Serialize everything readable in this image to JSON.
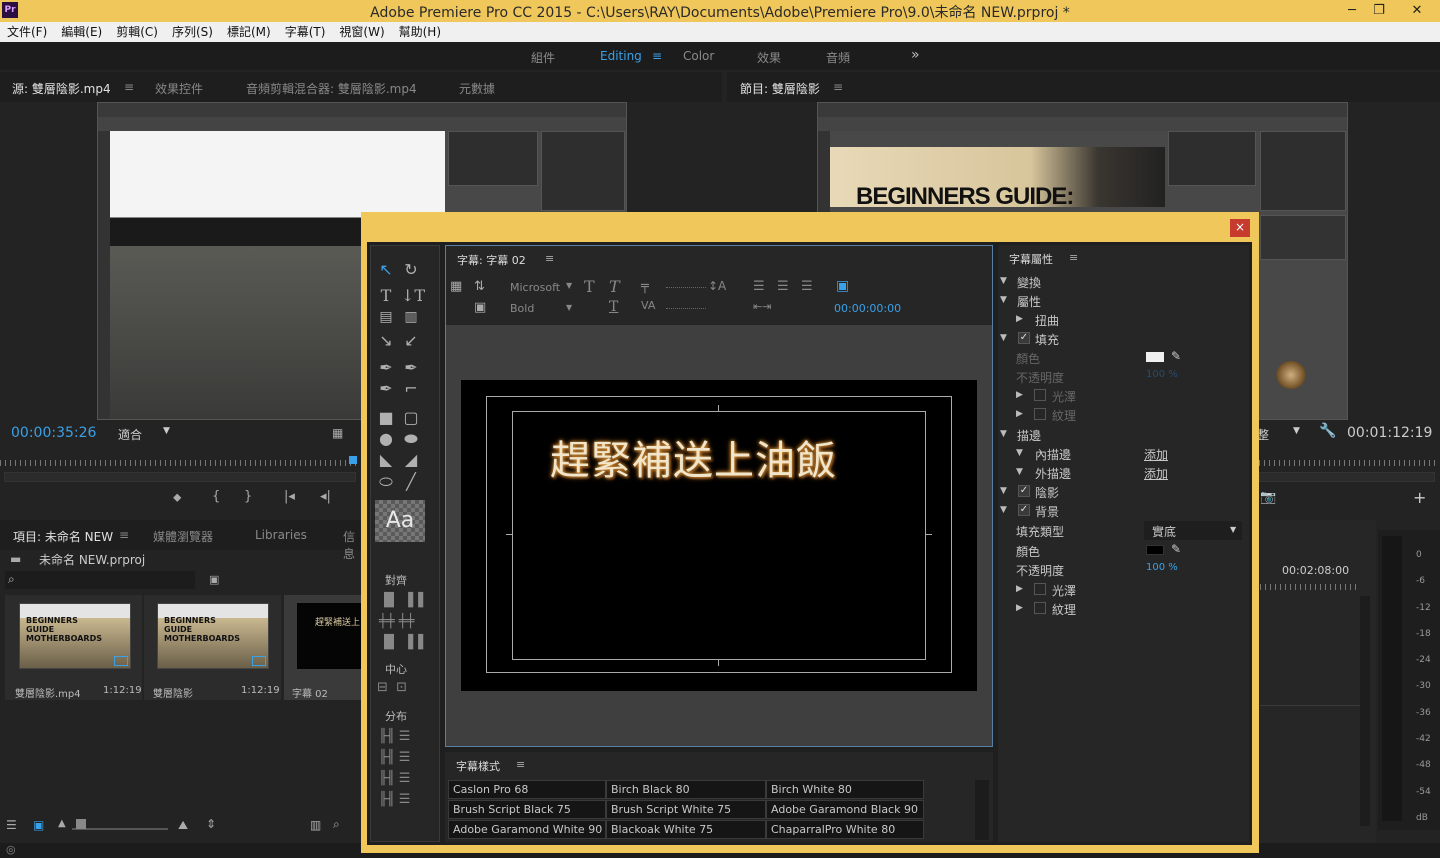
{
  "app": {
    "title": "Adobe Premiere Pro CC 2015 - C:\\Users\\RAY\\Documents\\Adobe\\Premiere Pro\\9.0\\未命名 NEW.prproj *",
    "logo": "Pr"
  },
  "menu": [
    "文件(F)",
    "編輯(E)",
    "剪輯(C)",
    "序列(S)",
    "標記(M)",
    "字幕(T)",
    "視窗(W)",
    "幫助(H)"
  ],
  "workspaces": {
    "items": [
      "組件",
      "Editing",
      "Color",
      "效果",
      "音頻"
    ],
    "active": "Editing",
    "more": "»"
  },
  "source": {
    "tabs": [
      "源: 雙層陰影.mp4",
      "效果控件",
      "音頻剪輯混合器: 雙層陰影.mp4",
      "元數據"
    ],
    "timecode": "00:00:35:26",
    "fit": "適合"
  },
  "program": {
    "tab": "節目: 雙層陰影",
    "timecode": "00:01:12:19",
    "fit": "整",
    "thumbtext": "BEGINNERS GUIDE:"
  },
  "project": {
    "tabs": [
      "項目: 未命名 NEW",
      "媒體瀏覽器",
      "Libraries",
      "信息"
    ],
    "file": "未命名 NEW.prproj",
    "items": [
      {
        "name": "雙層陰影.mp4",
        "duration": "1:12:19",
        "thumb": "BEGINNERS GUIDE MOTHERBOARDS"
      },
      {
        "name": "雙層陰影",
        "duration": "1:12:19",
        "thumb": "BEGINNERS GUIDE MOTHERBOARDS"
      },
      {
        "name": "字幕 02",
        "duration": "",
        "thumb": "趕緊補送上"
      }
    ]
  },
  "timeline": {
    "timecode": "00:02:08:00"
  },
  "meter": {
    "labels": [
      "0",
      "-6",
      "-12",
      "-18",
      "-24",
      "-30",
      "-36",
      "-42",
      "-48",
      "-54",
      "dB"
    ]
  },
  "dialog": {
    "close": "×",
    "titler": {
      "tab": "字幕: 字幕 02",
      "font": "Microsoft",
      "style": "Bold",
      "timecode": "00:00:00:00",
      "caption": "趕緊補送上油飯"
    },
    "toolbox": {
      "aa": "Aa",
      "align_label": "對齊",
      "center_label": "中心",
      "distribute_label": "分布"
    },
    "styles": {
      "tab": "字幕樣式",
      "cells": [
        [
          "Caslon Pro 68",
          "Birch Black 80",
          "Birch White 80"
        ],
        [
          "Brush Script Black 75",
          "Brush Script White 75",
          "Adobe Garamond Black 90"
        ],
        [
          "Adobe Garamond White 90",
          "Blackoak White 75",
          "ChaparralPro White 80"
        ]
      ]
    },
    "props": {
      "tab": "字幕屬性",
      "transform": "變換",
      "attributes": "屬性",
      "distort": "扭曲",
      "fill": "填充",
      "color": "顏色",
      "opacity": "不透明度",
      "opacity_val": "100 %",
      "sheen": "光澤",
      "texture": "紋理",
      "strokes": "描邊",
      "inner": "內描邊",
      "outer": "外描邊",
      "add": "添加",
      "shadow": "陰影",
      "background": "背景",
      "filltype": "填充類型",
      "filltype_val": "實底",
      "bg_color": "顏色",
      "bg_opacity": "不透明度",
      "bg_opacity_val": "100 %",
      "bg_sheen": "光澤",
      "bg_texture": "紋理"
    }
  }
}
